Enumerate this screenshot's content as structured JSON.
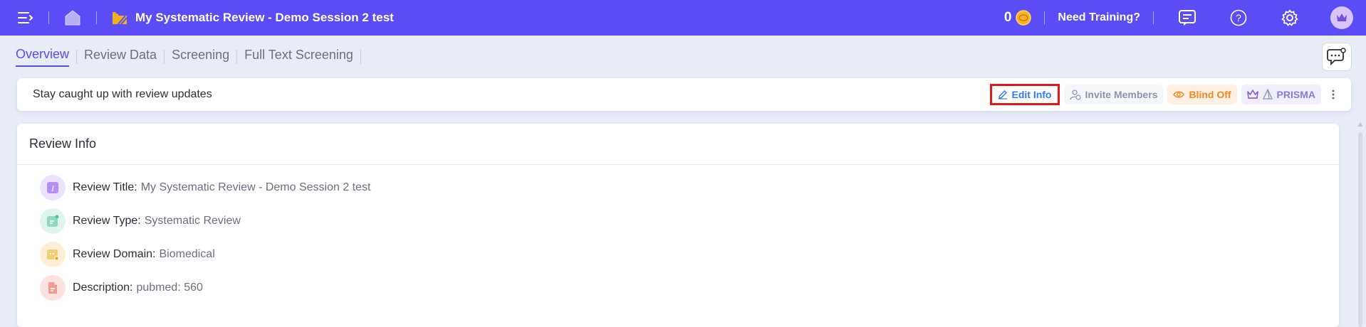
{
  "header": {
    "title": "My Systematic Review - Demo Session 2 test",
    "coins": "0",
    "training_label": "Need Training?",
    "icons": [
      "menu-toggle-icon",
      "home-icon",
      "review-folder-icon",
      "coin-icon",
      "chat-support-icon",
      "help-icon",
      "settings-icon",
      "user-avatar-icon"
    ],
    "colors": {
      "topbar": "#5b4cf5",
      "accent": "#5b4cf5"
    }
  },
  "tabs": [
    {
      "label": "Overview",
      "active": true
    },
    {
      "label": "Review Data",
      "active": false
    },
    {
      "label": "Screening",
      "active": false
    },
    {
      "label": "Full Text Screening",
      "active": false
    }
  ],
  "update_bar": {
    "text": "Stay caught up with review updates",
    "actions": {
      "edit": "Edit Info",
      "invite": "Invite Members",
      "blind": "Blind Off",
      "prisma": "PRISMA"
    }
  },
  "review_info": {
    "heading": "Review Info",
    "rows": [
      {
        "label": "Review Title:",
        "value": "My Systematic Review - Demo Session 2 test",
        "icon": "title-icon"
      },
      {
        "label": "Review Type:",
        "value": "Systematic Review",
        "icon": "type-icon"
      },
      {
        "label": "Review Domain:",
        "value": "Biomedical",
        "icon": "domain-icon"
      },
      {
        "label": "Description:",
        "value": "pubmed: 560",
        "icon": "description-icon"
      }
    ]
  }
}
